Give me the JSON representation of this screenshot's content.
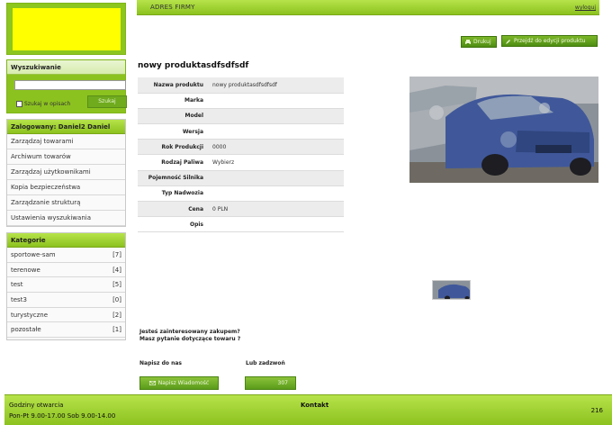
{
  "header": {
    "firm_name": "ADRES FIRMY",
    "logout": "wyloguj"
  },
  "search": {
    "title": "Wyszukiwanie",
    "query": "",
    "in_descriptions": "Szukaj w opisach",
    "submit": "Szukaj"
  },
  "user_panel": {
    "title": "Zalogowany: Daniel2 Daniel",
    "items": [
      "Zarządzaj towarami",
      "Archiwum towarów",
      "Zarządzaj użytkownikami",
      "Kopia bezpieczeństwa",
      "Zarządzanie strukturą",
      "Ustawienia wyszukiwania"
    ]
  },
  "categories": {
    "title": "Kategorie",
    "items": [
      {
        "name": "sportowe-sam",
        "count": "[7]"
      },
      {
        "name": "terenowe",
        "count": "[4]"
      },
      {
        "name": "test",
        "count": "[5]"
      },
      {
        "name": "test3",
        "count": "[0]"
      },
      {
        "name": "turystyczne",
        "count": "[2]"
      },
      {
        "name": "pozostałe",
        "count": "[1]"
      }
    ]
  },
  "actions": {
    "print": "Drukuj",
    "edit": "Przejdź do edycji produktu"
  },
  "product": {
    "title": "nowy produktasdfsdfsdf",
    "specs": [
      {
        "label": "Nazwa produktu",
        "value": "nowy produktasdfsdfsdf"
      },
      {
        "label": "Marka",
        "value": ""
      },
      {
        "label": "Model",
        "value": ""
      },
      {
        "label": "Wersja",
        "value": ""
      },
      {
        "label": "Rok Produkcji",
        "value": "0000"
      },
      {
        "label": "Rodzaj Paliwa",
        "value": "Wybierz"
      },
      {
        "label": "Pojemność Silnika",
        "value": ""
      },
      {
        "label": "Typ Nadwozia",
        "value": ""
      },
      {
        "label": "Cena",
        "value": "0 PLN"
      },
      {
        "label": "Opis",
        "value": ""
      }
    ]
  },
  "contact_box": {
    "question_1": "Jesteś zainteresowany zakupem?",
    "question_2": "Masz pytanie dotyczące towaru ?",
    "write_label": "Napisz do nas",
    "call_label": "Lub zadzwoń",
    "write_button": "Napisz Wiadomość",
    "phone": "307"
  },
  "footer": {
    "hours_title": "Godziny otwarcia",
    "hours": "Pon-Pt 9.00-17.00 Sob 9.00-14.00",
    "contact": "Kontakt",
    "number": "216"
  },
  "colors": {
    "accent": "#8cc21f",
    "logo_fill": "#ffff00",
    "button_dark": "#4e8d12"
  }
}
